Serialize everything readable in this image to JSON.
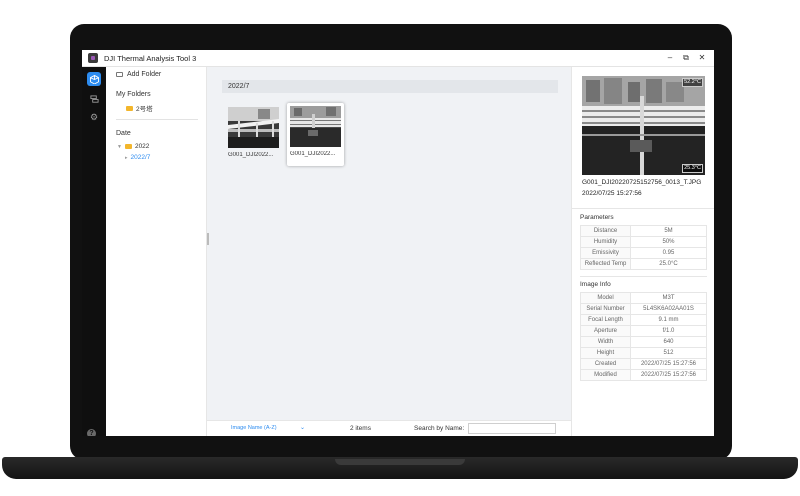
{
  "window": {
    "title": "DJI Thermal Analysis Tool 3",
    "controls": [
      "–",
      "⧉",
      "✕"
    ]
  },
  "sidebar": {
    "add_folder": "Add Folder",
    "my_folders_title": "My Folders",
    "folders": [
      "2号塔"
    ],
    "date_title": "Date",
    "year": "2022",
    "month": "2022/7"
  },
  "main": {
    "group_header": "2022/7",
    "thumbnails": [
      {
        "caption": "G001_DJI2022...",
        "selected": false
      },
      {
        "caption": "G001_DJI2022...",
        "selected": true
      }
    ]
  },
  "bottombar": {
    "sort_label": "Image Name (A-Z)",
    "item_count": "2 items",
    "search_label": "Search by Name:",
    "search_value": ""
  },
  "detail": {
    "max_temp": "52.2°C",
    "min_temp": "25.3°C",
    "filename": "G001_DJI20220725152756_0013_T.JPG",
    "datetime": "2022/07/25 15:27:56",
    "parameters_title": "Parameters",
    "parameters": [
      {
        "label": "Distance",
        "value": "5M"
      },
      {
        "label": "Humidity",
        "value": "50%"
      },
      {
        "label": "Emissivity",
        "value": "0.95"
      },
      {
        "label": "Reflected Temp",
        "value": "25.0°C"
      }
    ],
    "image_info_title": "Image Info",
    "image_info": [
      {
        "label": "Model",
        "value": "M3T"
      },
      {
        "label": "Serial Number",
        "value": "5L4SK6A02AA01S"
      },
      {
        "label": "Focal Length",
        "value": "9.1 mm"
      },
      {
        "label": "Aperture",
        "value": "f/1.0"
      },
      {
        "label": "Width",
        "value": "640"
      },
      {
        "label": "Height",
        "value": "512"
      },
      {
        "label": "Created",
        "value": "2022/07/25 15:27:56"
      },
      {
        "label": "Modified",
        "value": "2022/07/25 15:27:56"
      }
    ]
  },
  "colors": {
    "accent": "#2d8cf0",
    "folder": "#f3b62c",
    "rail": "#0f0f0f"
  },
  "icons": {
    "rail": [
      "cube-icon",
      "layers-icon",
      "gear-icon"
    ],
    "help": "help-icon"
  }
}
